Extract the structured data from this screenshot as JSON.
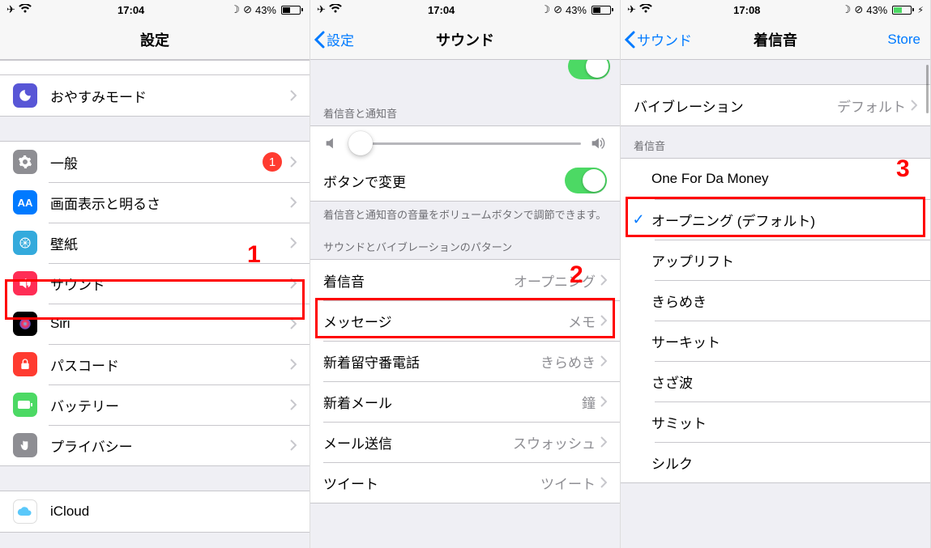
{
  "status": {
    "time_a": "17:04",
    "time_b": "17:04",
    "time_c": "17:08",
    "battery_pct": "43%"
  },
  "panel1": {
    "title": "設定",
    "rows": {
      "donotdisturb": "おやすみモード",
      "general": "一般",
      "general_badge": "1",
      "display": "画面表示と明るさ",
      "wallpaper": "壁紙",
      "sounds": "サウンド",
      "siri": "Siri",
      "passcode": "パスコード",
      "battery": "バッテリー",
      "privacy": "プライバシー",
      "icloud": "iCloud"
    }
  },
  "panel2": {
    "back": "設定",
    "title": "サウンド",
    "header1": "着信音と通知音",
    "change_with_buttons": "ボタンで変更",
    "footer1": "着信音と通知音の音量をボリュームボタンで調節できます。",
    "header2": "サウンドとバイブレーションのパターン",
    "ringtone_label": "着信音",
    "ringtone_value": "オープニング",
    "message_label": "メッセージ",
    "message_value": "メモ",
    "voicemail_label": "新着留守番電話",
    "voicemail_value": "きらめき",
    "newmail_label": "新着メール",
    "newmail_value": "鐘",
    "sentmail_label": "メール送信",
    "sentmail_value": "スウォッシュ",
    "tweet_label": "ツイート",
    "tweet_value": "ツイート"
  },
  "panel3": {
    "back": "サウンド",
    "title": "着信音",
    "store": "Store",
    "vibration_label": "バイブレーション",
    "vibration_value": "デフォルト",
    "header": "着信音",
    "items": [
      "One For Da Money",
      "オープニング (デフォルト)",
      "アップリフト",
      "きらめき",
      "サーキット",
      "さざ波",
      "サミット",
      "シルク"
    ],
    "selected_index": 1
  },
  "annotations": {
    "n1": "1",
    "n2": "2",
    "n3": "3"
  }
}
